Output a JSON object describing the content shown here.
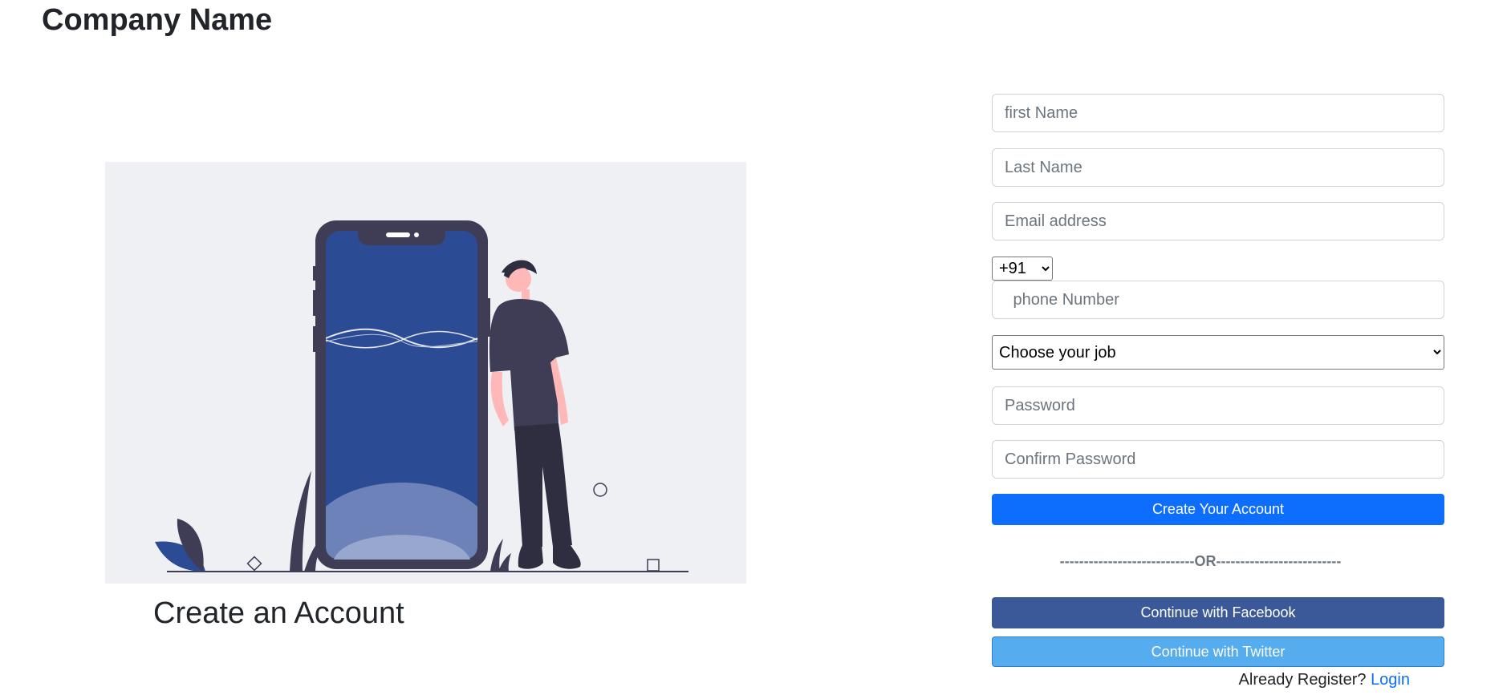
{
  "header": {
    "brand": "Company Name"
  },
  "hero": {
    "caption": "Create an Account"
  },
  "form": {
    "first_name_placeholder": "first Name",
    "last_name_placeholder": "Last Name",
    "email_placeholder": "Email address",
    "country_code": {
      "selected": "+91",
      "options": [
        "+91"
      ]
    },
    "phone_placeholder": " phone Number",
    "job_select": {
      "selected": "Choose your job",
      "options": [
        "Choose your job"
      ]
    },
    "password_placeholder": "Password",
    "confirm_password_placeholder": "Confirm Password",
    "create_button": "Create Your Account",
    "divider": "----------------------------OR--------------------------",
    "facebook_button": "Continue with Facebook",
    "twitter_button": "Continue with Twitter",
    "login_prompt": "Already Register?",
    "login_link": "Login"
  },
  "colors": {
    "primary": "#0d6efd",
    "facebook": "#3b5998",
    "twitter": "#55acee",
    "illustration_phone_screen": "#2b4c95",
    "illustration_background": "#eef0f3"
  }
}
